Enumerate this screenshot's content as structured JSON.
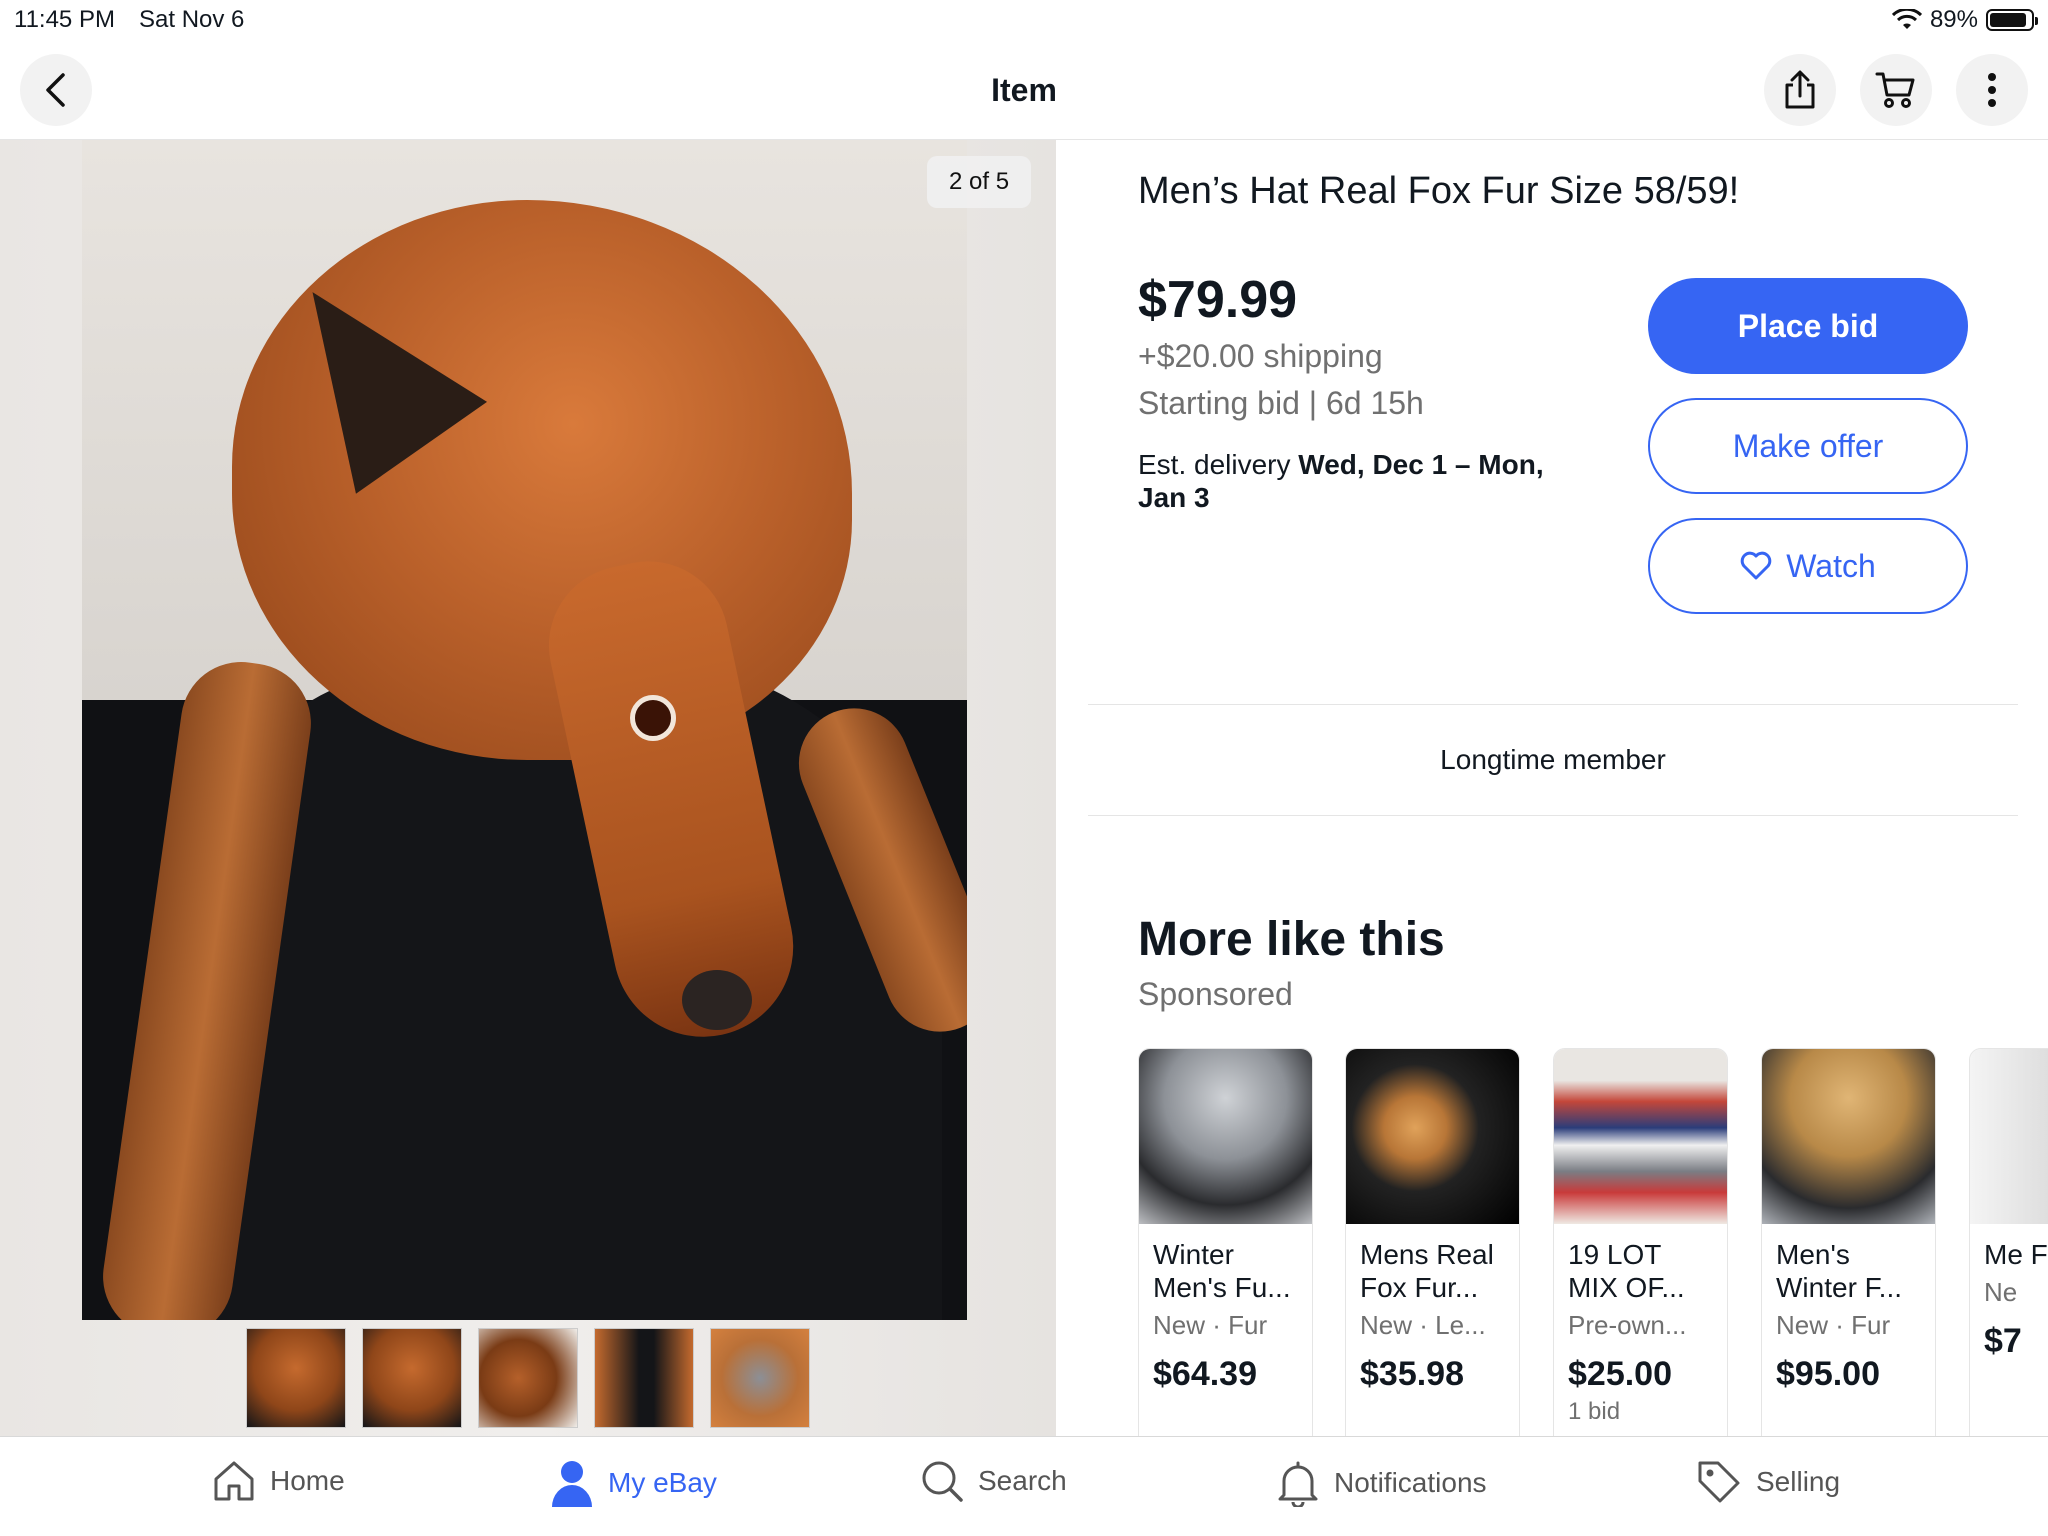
{
  "status_bar": {
    "time": "11:45 PM",
    "date": "Sat Nov 6",
    "battery": "89%"
  },
  "nav": {
    "title": "Item"
  },
  "gallery": {
    "counter": "2 of 5",
    "thumbnail_count": 5
  },
  "item": {
    "title": "Men’s Hat Real Fox Fur Size 58/59!",
    "price": "$79.99",
    "shipping": "+$20.00 shipping",
    "bid_info": "Starting bid | 6d 15h",
    "delivery_prefix": "Est. delivery",
    "delivery_dates": "Wed, Dec 1 – Mon, Jan 3"
  },
  "actions": {
    "place_bid": "Place bid",
    "make_offer": "Make offer",
    "watch": "Watch"
  },
  "seller": {
    "badge": "Longtime member"
  },
  "more_like_this": {
    "title": "More like this",
    "subtitle": "Sponsored",
    "items": [
      {
        "name": "Winter Men's Fu...",
        "condition": "New · Fur",
        "price": "$64.39",
        "bids": ""
      },
      {
        "name": "Mens Real Fox Fur...",
        "condition": "New · Le...",
        "price": "$35.98",
        "bids": ""
      },
      {
        "name": "19 LOT MIX OF...",
        "condition": "Pre-own...",
        "price": "$25.00",
        "bids": "1 bid"
      },
      {
        "name": "Men's Winter F...",
        "condition": "New · Fur",
        "price": "$95.00",
        "bids": ""
      },
      {
        "name": "Me Fo",
        "condition": "Ne",
        "price": "$7",
        "bids": ""
      }
    ]
  },
  "tabbar": {
    "home": "Home",
    "my_ebay": "My eBay",
    "search": "Search",
    "notifications": "Notifications",
    "selling": "Selling"
  },
  "colors": {
    "accent": "#3665f3",
    "text": "#111820",
    "secondary_text": "#707070"
  }
}
